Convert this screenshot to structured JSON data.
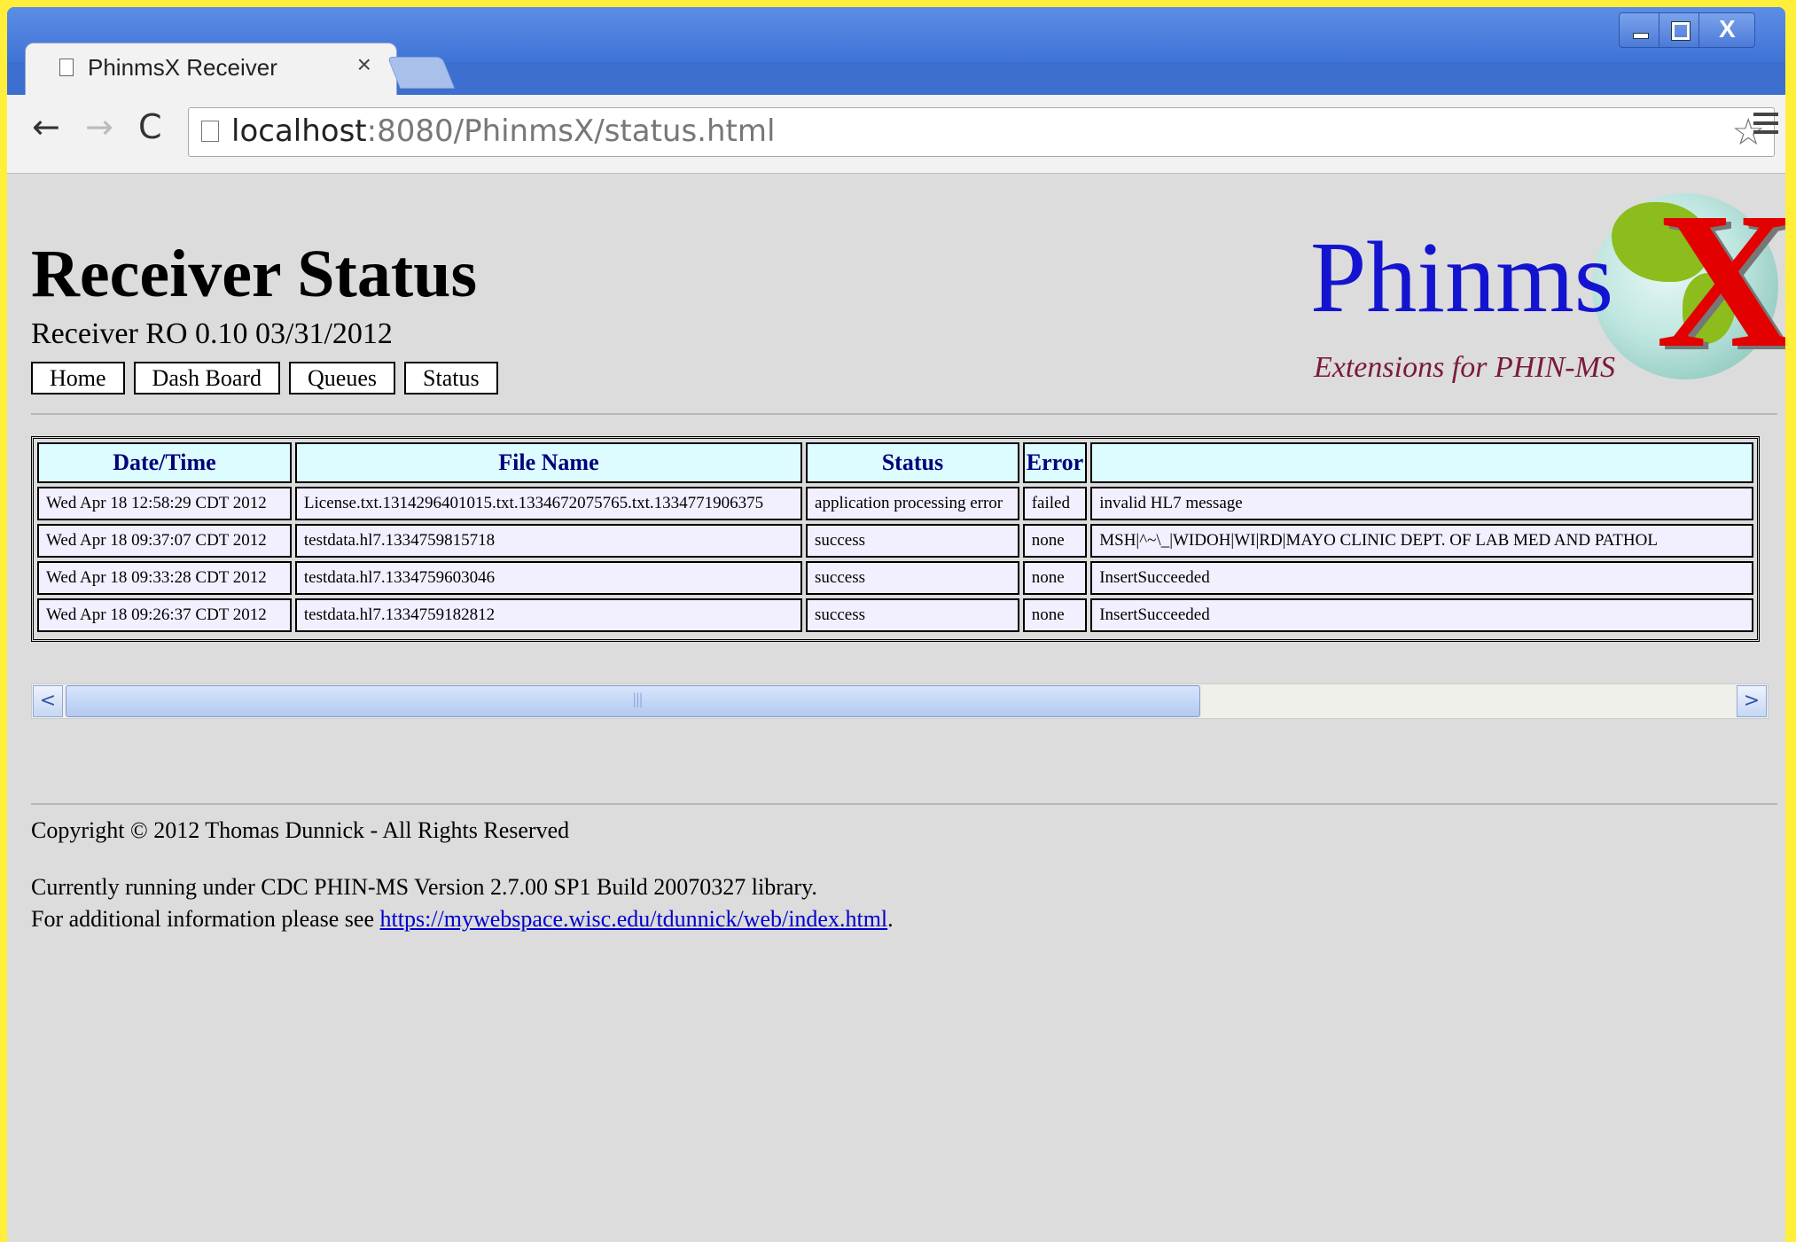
{
  "browser": {
    "tab_title": "PhinmsX Receiver",
    "tab_close": "×",
    "url_host": "localhost",
    "url_rest": ":8080/PhinmsX/status.html",
    "icons": [
      "back-icon",
      "forward-icon",
      "reload-icon",
      "page-icon",
      "star-icon",
      "menu-icon"
    ],
    "back": "←",
    "forward": "→",
    "reload": "C",
    "star": "☆",
    "close_x": "X"
  },
  "page": {
    "title": "Receiver Status",
    "version": "Receiver RO 0.10 03/31/2012",
    "nav": [
      "Home",
      "Dash Board",
      "Queues",
      "Status"
    ],
    "logo": {
      "word": "Phinms",
      "x": "X",
      "tagline": "Extensions for PHIN-MS"
    }
  },
  "table": {
    "headers": [
      "Date/Time",
      "File Name",
      "Status",
      "Error",
      ""
    ],
    "rows": [
      [
        "Wed Apr 18 12:58:29 CDT 2012",
        "License.txt.1314296401015.txt.1334672075765.txt.1334771906375",
        "application processing error",
        "failed",
        "invalid HL7 message"
      ],
      [
        "Wed Apr 18 09:37:07 CDT 2012",
        "testdata.hl7.1334759815718",
        "success",
        "none",
        "MSH|^~\\_|WIDOH|WI|RD|MAYO CLINIC DEPT. OF LAB MED AND PATHOL"
      ],
      [
        "Wed Apr 18 09:33:28 CDT 2012",
        "testdata.hl7.1334759603046",
        "success",
        "none",
        "InsertSucceeded"
      ],
      [
        "Wed Apr 18 09:26:37 CDT 2012",
        "testdata.hl7.1334759182812",
        "success",
        "none",
        "InsertSucceeded"
      ]
    ]
  },
  "scrollbar": {
    "left": "<",
    "right": ">"
  },
  "footer": {
    "copyright": "Copyright © 2012 Thomas Dunnick - All Rights Reserved",
    "running": "Currently running under CDC PHIN-MS Version 2.7.00 SP1 Build 20070327 library.",
    "info_prefix": "For additional information please see ",
    "info_link": "https://mywebspace.wisc.edu/tdunnick/web/index.html",
    "info_suffix": "."
  }
}
